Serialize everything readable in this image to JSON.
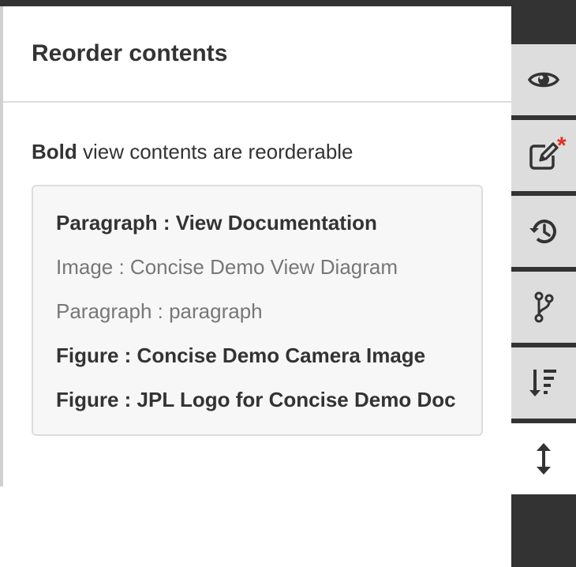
{
  "panel": {
    "title": "Reorder contents",
    "hint_bold": "Bold",
    "hint_rest": " view contents are reorderable",
    "items": [
      {
        "label": "Paragraph : View Documentation",
        "reorderable": true
      },
      {
        "label": "Image : Concise Demo View Diagram",
        "reorderable": false
      },
      {
        "label": "Paragraph : paragraph",
        "reorderable": false
      },
      {
        "label": "Figure : Concise Demo Camera Image",
        "reorderable": true
      },
      {
        "label": "Figure : JPL Logo for Concise Demo Doc",
        "reorderable": true
      }
    ]
  },
  "rail": {
    "buttons": [
      {
        "icon": "eye-icon",
        "name": "preview"
      },
      {
        "icon": "edit-icon",
        "name": "edit",
        "badge": "*"
      },
      {
        "icon": "history-icon",
        "name": "history"
      },
      {
        "icon": "branch-icon",
        "name": "branches"
      },
      {
        "icon": "sort-icon",
        "name": "reorder-view"
      },
      {
        "icon": "vertical-resize-icon",
        "name": "reorder-contents",
        "active": true
      }
    ]
  },
  "colors": {
    "dark": "#333333",
    "rail_button": "#dddddd",
    "badge": "#e22d1f",
    "muted_text": "#777777"
  }
}
